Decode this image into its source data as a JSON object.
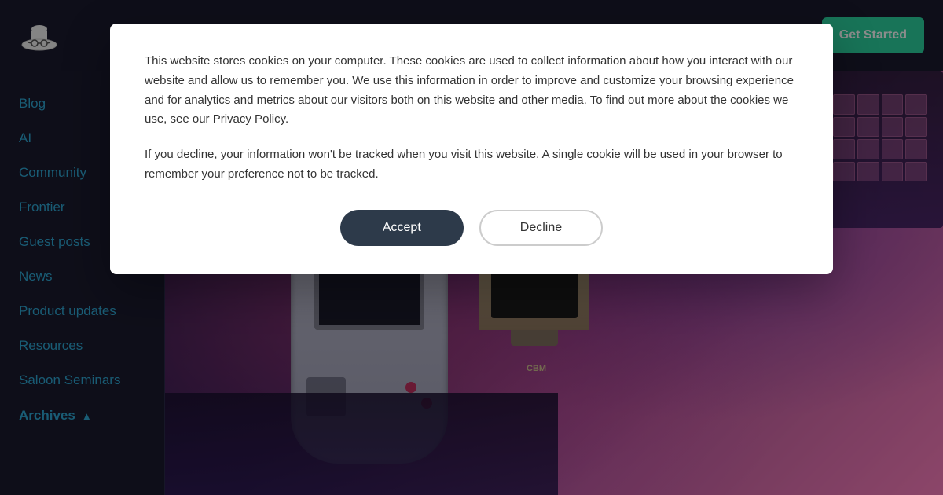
{
  "header": {
    "logo_alt": "Hat with glasses logo",
    "get_started_label": "Get Started"
  },
  "sidebar": {
    "items": [
      {
        "id": "blog",
        "label": "Blog"
      },
      {
        "id": "ai",
        "label": "AI"
      },
      {
        "id": "community",
        "label": "Community"
      },
      {
        "id": "frontier",
        "label": "Frontier"
      },
      {
        "id": "guest-posts",
        "label": "Guest posts"
      },
      {
        "id": "news",
        "label": "News"
      },
      {
        "id": "product-updates",
        "label": "Product updates"
      },
      {
        "id": "resources",
        "label": "Resources"
      },
      {
        "id": "saloon-seminars",
        "label": "Saloon Seminars"
      }
    ],
    "archives_label": "Archives",
    "archives_chevron": "▲"
  },
  "cookie_modal": {
    "text_main": "This website stores cookies on your computer. These cookies are used to collect information about how you interact with our website and allow us to remember you. We use this information in order to improve and customize your browsing experience and for analytics and metrics about our visitors both on this website and other media. To find out more about the cookies we use, see our Privacy Policy.",
    "text_secondary": "If you decline, your information won't be tracked when you visit this website. A single cookie will be used in your browser to remember your preference not to be tracked.",
    "accept_label": "Accept",
    "decline_label": "Decline"
  }
}
